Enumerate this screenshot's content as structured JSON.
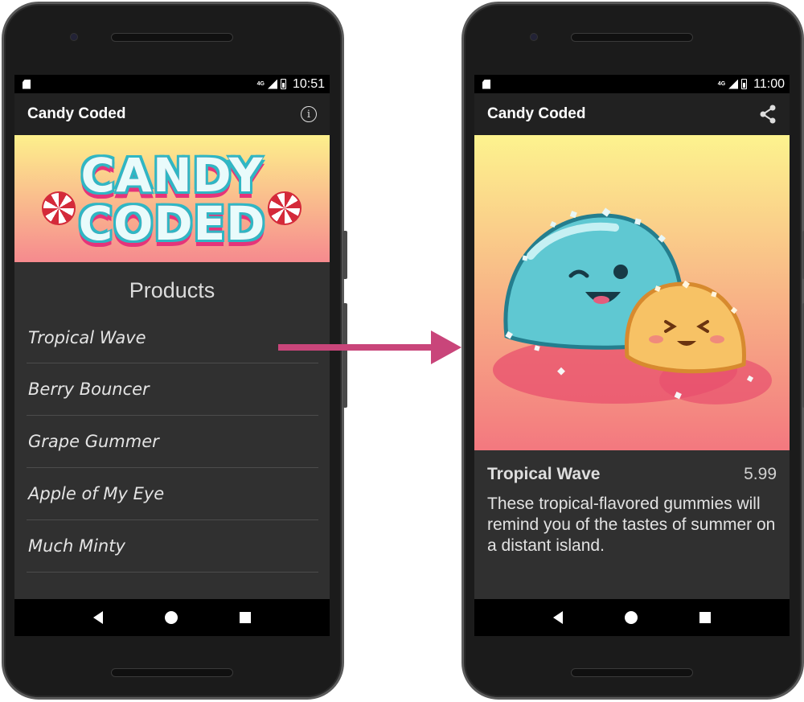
{
  "colors": {
    "arrow": "#c9457a",
    "app_bar": "#212121",
    "screen_bg": "#303030",
    "banner_gradient": [
      "#fdf08c",
      "#f68a8e"
    ],
    "logo_fill": "#e9fbfb",
    "logo_outline": "#2fb7c4",
    "logo_shadow": "#e5347a"
  },
  "left_phone": {
    "status": {
      "network": "4G",
      "time": "10:51"
    },
    "app_title": "Candy Coded",
    "action_icon": "info-icon",
    "logo": {
      "line1": "CANDY",
      "line2": "CODED"
    },
    "heading": "Products",
    "products": [
      "Tropical Wave",
      "Berry Bouncer",
      "Grape Gummer",
      "Apple of My Eye",
      "Much Minty"
    ]
  },
  "right_phone": {
    "status": {
      "network": "4G",
      "time": "11:00"
    },
    "app_title": "Candy Coded",
    "action_icon": "share-icon",
    "product": {
      "name": "Tropical Wave",
      "price": "5.99",
      "description": "These tropical-flavored gummies will remind you of the tastes of summer on a distant island."
    }
  },
  "nav_icons": [
    "back-icon",
    "home-icon",
    "recents-icon"
  ]
}
